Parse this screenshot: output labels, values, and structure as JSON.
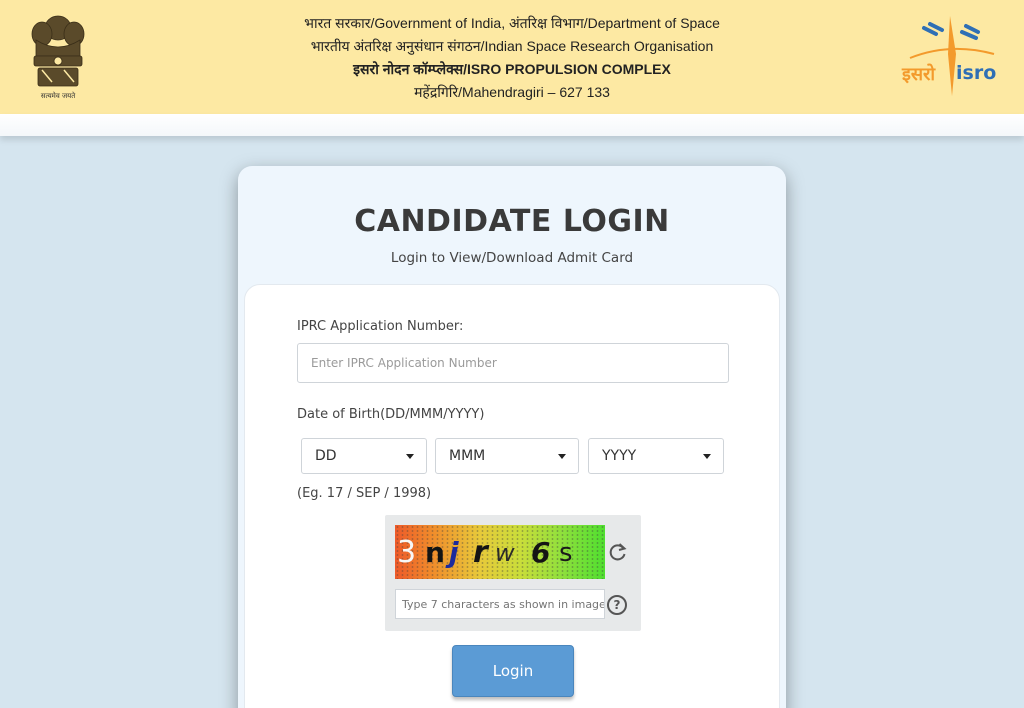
{
  "header": {
    "line1": "भारत सरकार/Government of India, अंतरिक्ष विभाग/Department of Space",
    "line2": "भारतीय अंतरिक्ष अनुसंधान संगठन/Indian Space Research Organisation",
    "line3": "इसरो नोदन कॉम्प्लेक्स/ISRO PROPULSION COMPLEX",
    "line4": "महेंद्रगिरि/Mahendragiri – 627 133",
    "emblem_motto": "सत्यमेव जयते",
    "logo_text_hindi": "इसरो",
    "logo_text_english": "isro"
  },
  "login": {
    "title": "CANDIDATE LOGIN",
    "subtitle": "Login to View/Download Admit Card",
    "app_number_label": "IPRC Application Number:",
    "app_number_placeholder": "Enter IPRC Application Number",
    "dob_label": "Date of Birth(DD/MMM/YYYY)",
    "dob_day": "DD",
    "dob_month": "MMM",
    "dob_year": "YYYY",
    "dob_example": "(Eg. 17 / SEP / 1998)",
    "captcha_chars": [
      "3",
      "n",
      "j",
      "r",
      "w",
      "6",
      "s"
    ],
    "captcha_placeholder": "Type 7 characters as shown in image",
    "help_symbol": "?",
    "login_button": "Login"
  },
  "icons": {
    "refresh": "refresh-icon",
    "help": "help-icon",
    "dropdown": "chevron-down-icon"
  },
  "colors": {
    "header_bg": "#fde9a3",
    "page_bg": "#d5e5ef",
    "button": "#5b9bd5",
    "logo_orange": "#f39a2c",
    "logo_blue": "#2f6fb5"
  }
}
